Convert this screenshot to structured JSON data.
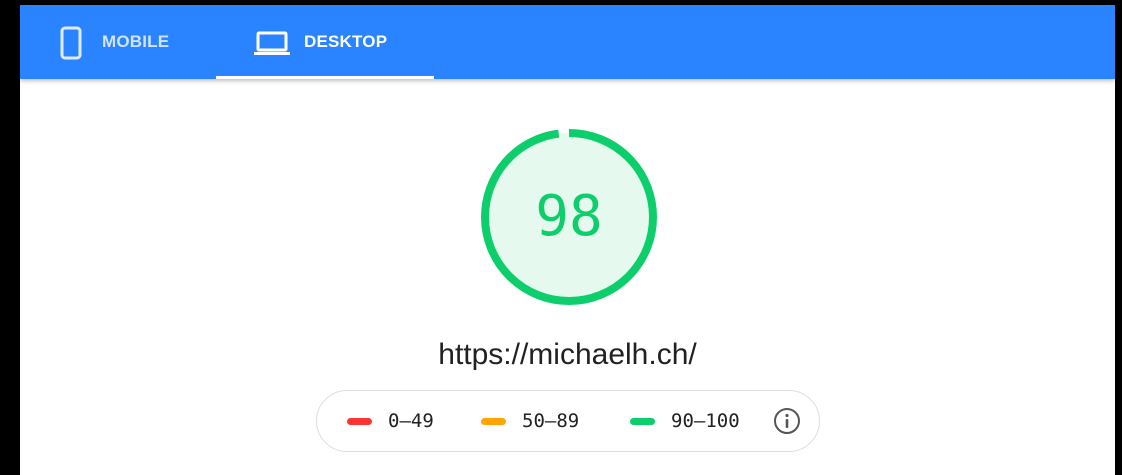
{
  "tabs": [
    {
      "label": "MOBILE",
      "icon": "smartphone-icon",
      "selected": false
    },
    {
      "label": "DESKTOP",
      "icon": "laptop-icon",
      "selected": true
    }
  ],
  "report": {
    "score": "98",
    "score_fraction": 0.98,
    "url": "https://michaelh.ch/"
  },
  "legend": [
    {
      "label": "0–49",
      "color": "#ff3333"
    },
    {
      "label": "50–89",
      "color": "#ffa400"
    },
    {
      "label": "90–100",
      "color": "#0cce6b"
    }
  ],
  "legend_info_icon": "info-icon",
  "colors": {
    "accent": "#2a83ff",
    "pass": "#0cce6b",
    "pass_fill": "#e5f9ef"
  }
}
